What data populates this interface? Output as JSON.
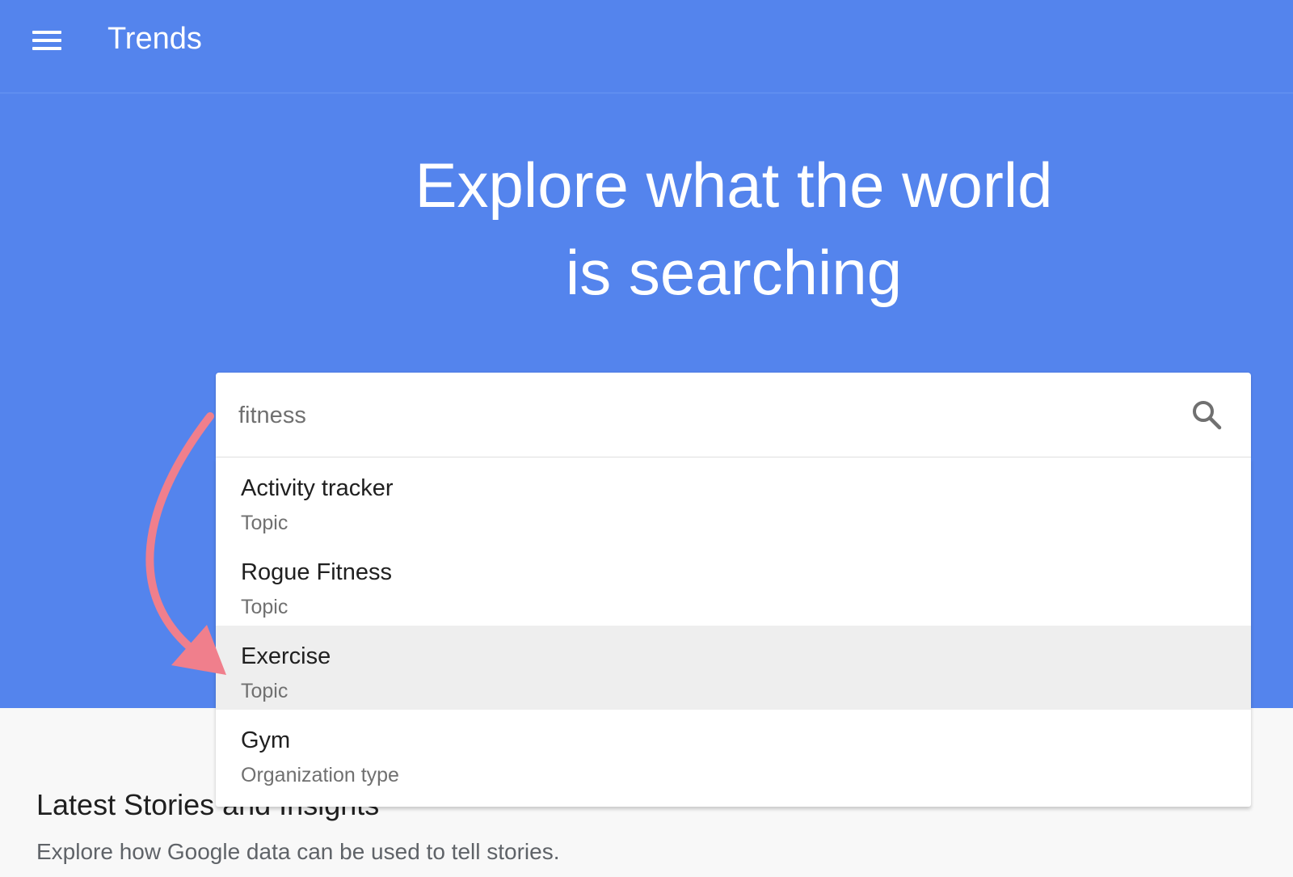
{
  "header": {
    "menu_icon": "hamburger-menu-icon",
    "app_title": "Trends"
  },
  "hero": {
    "headline_line1": "Explore what the world",
    "headline_line2": "is searching"
  },
  "search": {
    "value": "fitness",
    "icon": "search-icon"
  },
  "suggestions": [
    {
      "label": "Activity tracker",
      "type": "Topic"
    },
    {
      "label": "Rogue Fitness",
      "type": "Topic"
    },
    {
      "label": "Exercise",
      "type": "Topic"
    },
    {
      "label": "Gym",
      "type": "Organization type"
    }
  ],
  "latest": {
    "title": "Latest Stories and Insights",
    "subtitle": "Explore how Google data can be used to tell stories."
  },
  "colors": {
    "hero_bg": "#5484ed",
    "highlight_bg": "#eeeeee",
    "annotation_arrow": "#f07f8c"
  }
}
